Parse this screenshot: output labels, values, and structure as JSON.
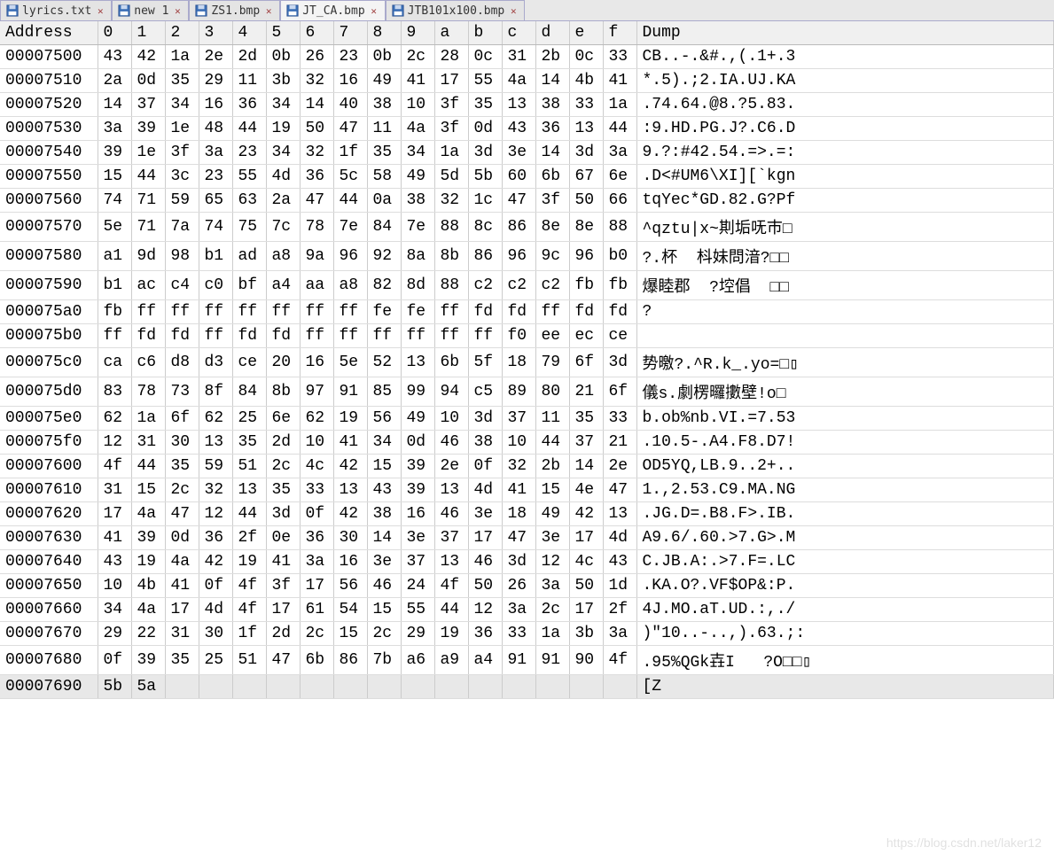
{
  "tabs": [
    {
      "label": "lyrics.txt",
      "active": false,
      "icon": "disk-icon"
    },
    {
      "label": "new 1",
      "active": false,
      "icon": "disk-icon"
    },
    {
      "label": "ZS1.bmp",
      "active": false,
      "icon": "disk-icon"
    },
    {
      "label": "JT_CA.bmp",
      "active": true,
      "icon": "disk-icon"
    },
    {
      "label": "JTB101x100.bmp",
      "active": false,
      "icon": "disk-icon"
    }
  ],
  "headers": {
    "address": "Address",
    "cols": [
      "0",
      "1",
      "2",
      "3",
      "4",
      "5",
      "6",
      "7",
      "8",
      "9",
      "a",
      "b",
      "c",
      "d",
      "e",
      "f"
    ],
    "dump": "Dump"
  },
  "rows": [
    {
      "addr": "00007500",
      "h": [
        "43",
        "42",
        "1a",
        "2e",
        "2d",
        "0b",
        "26",
        "23",
        "0b",
        "2c",
        "28",
        "0c",
        "31",
        "2b",
        "0c",
        "33"
      ],
      "dump": "CB..-.&#.,(.1+.3"
    },
    {
      "addr": "00007510",
      "h": [
        "2a",
        "0d",
        "35",
        "29",
        "11",
        "3b",
        "32",
        "16",
        "49",
        "41",
        "17",
        "55",
        "4a",
        "14",
        "4b",
        "41"
      ],
      "dump": "*.5).;2.IA.UJ.KA"
    },
    {
      "addr": "00007520",
      "h": [
        "14",
        "37",
        "34",
        "16",
        "36",
        "34",
        "14",
        "40",
        "38",
        "10",
        "3f",
        "35",
        "13",
        "38",
        "33",
        "1a"
      ],
      "dump": ".74.64.@8.?5.83."
    },
    {
      "addr": "00007530",
      "h": [
        "3a",
        "39",
        "1e",
        "48",
        "44",
        "19",
        "50",
        "47",
        "11",
        "4a",
        "3f",
        "0d",
        "43",
        "36",
        "13",
        "44"
      ],
      "dump": ":9.HD.PG.J?.C6.D"
    },
    {
      "addr": "00007540",
      "h": [
        "39",
        "1e",
        "3f",
        "3a",
        "23",
        "34",
        "32",
        "1f",
        "35",
        "34",
        "1a",
        "3d",
        "3e",
        "14",
        "3d",
        "3a"
      ],
      "dump": "9.?:#42.54.=>.=:"
    },
    {
      "addr": "00007550",
      "h": [
        "15",
        "44",
        "3c",
        "23",
        "55",
        "4d",
        "36",
        "5c",
        "58",
        "49",
        "5d",
        "5b",
        "60",
        "6b",
        "67",
        "6e"
      ],
      "dump": ".D<#UM6\\XI][`kgn"
    },
    {
      "addr": "00007560",
      "h": [
        "74",
        "71",
        "59",
        "65",
        "63",
        "2a",
        "47",
        "44",
        "0a",
        "38",
        "32",
        "1c",
        "47",
        "3f",
        "50",
        "66"
      ],
      "dump": "tqYec*GD.82.G?Pf"
    },
    {
      "addr": "00007570",
      "h": [
        "5e",
        "71",
        "7a",
        "74",
        "75",
        "7c",
        "78",
        "7e",
        "84",
        "7e",
        "88",
        "8c",
        "86",
        "8e",
        "8e",
        "88"
      ],
      "dump": "^qztu|x~剘垢呒巿□"
    },
    {
      "addr": "00007580",
      "h": [
        "a1",
        "9d",
        "98",
        "b1",
        "ad",
        "a8",
        "9a",
        "96",
        "92",
        "8a",
        "8b",
        "86",
        "96",
        "9c",
        "96",
        "b0"
      ],
      "dump": "?.杯  枓妹問湆?□□"
    },
    {
      "addr": "00007590",
      "h": [
        "b1",
        "ac",
        "c4",
        "c0",
        "bf",
        "a4",
        "aa",
        "a8",
        "82",
        "8d",
        "88",
        "c2",
        "c2",
        "c2",
        "fb",
        "fb"
      ],
      "dump": "爆睦郡  ?埪倡  □□"
    },
    {
      "addr": "000075a0",
      "h": [
        "fb",
        "ff",
        "ff",
        "ff",
        "ff",
        "ff",
        "ff",
        "ff",
        "fe",
        "fe",
        "ff",
        "fd",
        "fd",
        "ff",
        "fd",
        "fd"
      ],
      "dump": "?"
    },
    {
      "addr": "000075b0",
      "h": [
        "ff",
        "fd",
        "fd",
        "ff",
        "fd",
        "fd",
        "ff",
        "ff",
        "ff",
        "ff",
        "ff",
        "ff",
        "f0",
        "ee",
        "ec",
        "ce"
      ],
      "dump": ""
    },
    {
      "addr": "000075c0",
      "h": [
        "ca",
        "c6",
        "d8",
        "d3",
        "ce",
        "20",
        "16",
        "5e",
        "52",
        "13",
        "6b",
        "5f",
        "18",
        "79",
        "6f",
        "3d"
      ],
      "dump": "势曒?.^R.k_.yo=□▯"
    },
    {
      "addr": "000075d0",
      "h": [
        "83",
        "78",
        "73",
        "8f",
        "84",
        "8b",
        "97",
        "91",
        "85",
        "99",
        "94",
        "c5",
        "89",
        "80",
        "21",
        "6f"
      ],
      "dump": "儀s.劇楞曪擻壁!o□"
    },
    {
      "addr": "000075e0",
      "h": [
        "62",
        "1a",
        "6f",
        "62",
        "25",
        "6e",
        "62",
        "19",
        "56",
        "49",
        "10",
        "3d",
        "37",
        "11",
        "35",
        "33"
      ],
      "dump": "b.ob%nb.VI.=7.53"
    },
    {
      "addr": "000075f0",
      "h": [
        "12",
        "31",
        "30",
        "13",
        "35",
        "2d",
        "10",
        "41",
        "34",
        "0d",
        "46",
        "38",
        "10",
        "44",
        "37",
        "21"
      ],
      "dump": ".10.5-.A4.F8.D7!"
    },
    {
      "addr": "00007600",
      "h": [
        "4f",
        "44",
        "35",
        "59",
        "51",
        "2c",
        "4c",
        "42",
        "15",
        "39",
        "2e",
        "0f",
        "32",
        "2b",
        "14",
        "2e"
      ],
      "dump": "OD5YQ,LB.9..2+.."
    },
    {
      "addr": "00007610",
      "h": [
        "31",
        "15",
        "2c",
        "32",
        "13",
        "35",
        "33",
        "13",
        "43",
        "39",
        "13",
        "4d",
        "41",
        "15",
        "4e",
        "47"
      ],
      "dump": "1.,2.53.C9.MA.NG"
    },
    {
      "addr": "00007620",
      "h": [
        "17",
        "4a",
        "47",
        "12",
        "44",
        "3d",
        "0f",
        "42",
        "38",
        "16",
        "46",
        "3e",
        "18",
        "49",
        "42",
        "13"
      ],
      "dump": ".JG.D=.B8.F>.IB."
    },
    {
      "addr": "00007630",
      "h": [
        "41",
        "39",
        "0d",
        "36",
        "2f",
        "0e",
        "36",
        "30",
        "14",
        "3e",
        "37",
        "17",
        "47",
        "3e",
        "17",
        "4d"
      ],
      "dump": "A9.6/.60.>7.G>.M"
    },
    {
      "addr": "00007640",
      "h": [
        "43",
        "19",
        "4a",
        "42",
        "19",
        "41",
        "3a",
        "16",
        "3e",
        "37",
        "13",
        "46",
        "3d",
        "12",
        "4c",
        "43"
      ],
      "dump": "C.JB.A:.>7.F=.LC"
    },
    {
      "addr": "00007650",
      "h": [
        "10",
        "4b",
        "41",
        "0f",
        "4f",
        "3f",
        "17",
        "56",
        "46",
        "24",
        "4f",
        "50",
        "26",
        "3a",
        "50",
        "1d"
      ],
      "dump": ".KA.O?.VF$OP&:P."
    },
    {
      "addr": "00007660",
      "h": [
        "34",
        "4a",
        "17",
        "4d",
        "4f",
        "17",
        "61",
        "54",
        "15",
        "55",
        "44",
        "12",
        "3a",
        "2c",
        "17",
        "2f"
      ],
      "dump": "4J.MO.aT.UD.:,./"
    },
    {
      "addr": "00007670",
      "h": [
        "29",
        "22",
        "31",
        "30",
        "1f",
        "2d",
        "2c",
        "15",
        "2c",
        "29",
        "19",
        "36",
        "33",
        "1a",
        "3b",
        "3a"
      ],
      "dump": ")\"10..-..,).63.;:"
    },
    {
      "addr": "00007680",
      "h": [
        "0f",
        "39",
        "35",
        "25",
        "51",
        "47",
        "6b",
        "86",
        "7b",
        "a6",
        "a9",
        "a4",
        "91",
        "91",
        "90",
        "4f"
      ],
      "dump": ".95%QGk壵I   ?O□□▯"
    }
  ],
  "current": {
    "addr": "00007690",
    "bytes": [
      "5b",
      "5a"
    ],
    "dump": "[Z"
  },
  "watermark": "https://blog.csdn.net/laker12"
}
